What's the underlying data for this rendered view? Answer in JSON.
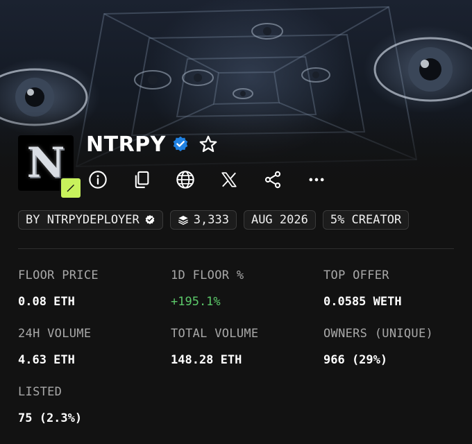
{
  "collection": {
    "name": "NTRPY",
    "avatar_letter": "N",
    "verified": true,
    "icons": {
      "verified": "verified-check-icon",
      "favorite": "star-outline-icon",
      "creator_badge": "pen-nib-icon"
    }
  },
  "actions": [
    {
      "name": "info-button",
      "icon": "info-circle-icon"
    },
    {
      "name": "copy-button",
      "icon": "copy-icon"
    },
    {
      "name": "website-button",
      "icon": "globe-icon"
    },
    {
      "name": "x-button",
      "icon": "x-logo-icon"
    },
    {
      "name": "share-button",
      "icon": "share-icon"
    },
    {
      "name": "more-button",
      "icon": "more-horizontal-icon"
    }
  ],
  "chips": {
    "creator": "BY NTRPYDEPLOYER",
    "items_count": "3,333",
    "date": "AUG 2026",
    "royalty": "5% CREATOR"
  },
  "stats": {
    "floor_price": {
      "label": "FLOOR PRICE",
      "value": "0.08 ETH"
    },
    "floor_change": {
      "label": "1D FLOOR %",
      "value": "+195.1%"
    },
    "top_offer": {
      "label": "TOP OFFER",
      "value": "0.0585 WETH"
    },
    "volume_24h": {
      "label": "24H VOLUME",
      "value": "4.63 ETH"
    },
    "total_volume": {
      "label": "TOTAL VOLUME",
      "value": "148.28 ETH"
    },
    "owners": {
      "label": "OWNERS (UNIQUE)",
      "value": "966 (29%)"
    },
    "listed": {
      "label": "LISTED",
      "value": "75 (2.3%)"
    }
  },
  "colors": {
    "background": "#121212",
    "positive": "#5cc96a",
    "verified_blue": "#2081e2",
    "badge_green": "#c8f25c"
  }
}
